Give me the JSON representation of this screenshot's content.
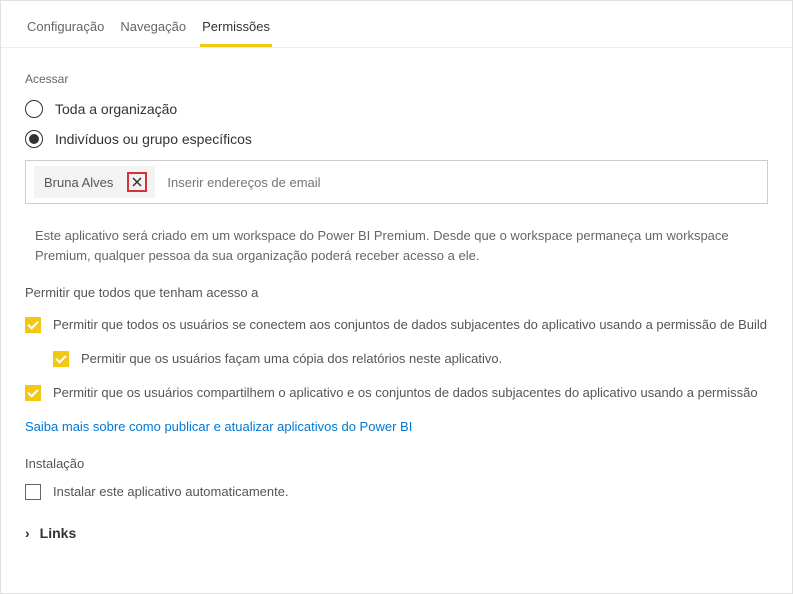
{
  "tabs": {
    "config": "Configuração",
    "nav": "Navegação",
    "perm": "Permissões"
  },
  "access": {
    "label": "Acessar",
    "option_org": "Toda a organização",
    "option_individuals": "Indivíduos ou grupo específicos",
    "chip_name": "Bruna Alves",
    "placeholder": "Inserir endereços de email",
    "info": "Este aplicativo será criado em um workspace do Power BI Premium. Desde que o workspace permaneça um workspace Premium, qualquer pessoa da sua organização poderá receber acesso a ele."
  },
  "permissions": {
    "header": "Permitir que todos que tenham acesso a",
    "cb1": "Permitir que todos os usuários se conectem aos conjuntos de dados subjacentes do aplicativo usando a permissão de Build",
    "cb2": "Permitir que os usuários façam uma cópia dos relatórios neste aplicativo.",
    "cb3": "Permitir que os usuários compartilhem o aplicativo e os conjuntos de dados subjacentes do aplicativo usando a permissão",
    "learn_more": "Saiba mais sobre como publicar e atualizar aplicativos do Power BI"
  },
  "install": {
    "header": "Instalação",
    "cb": "Instalar este aplicativo automaticamente."
  },
  "links": {
    "label": "Links"
  }
}
